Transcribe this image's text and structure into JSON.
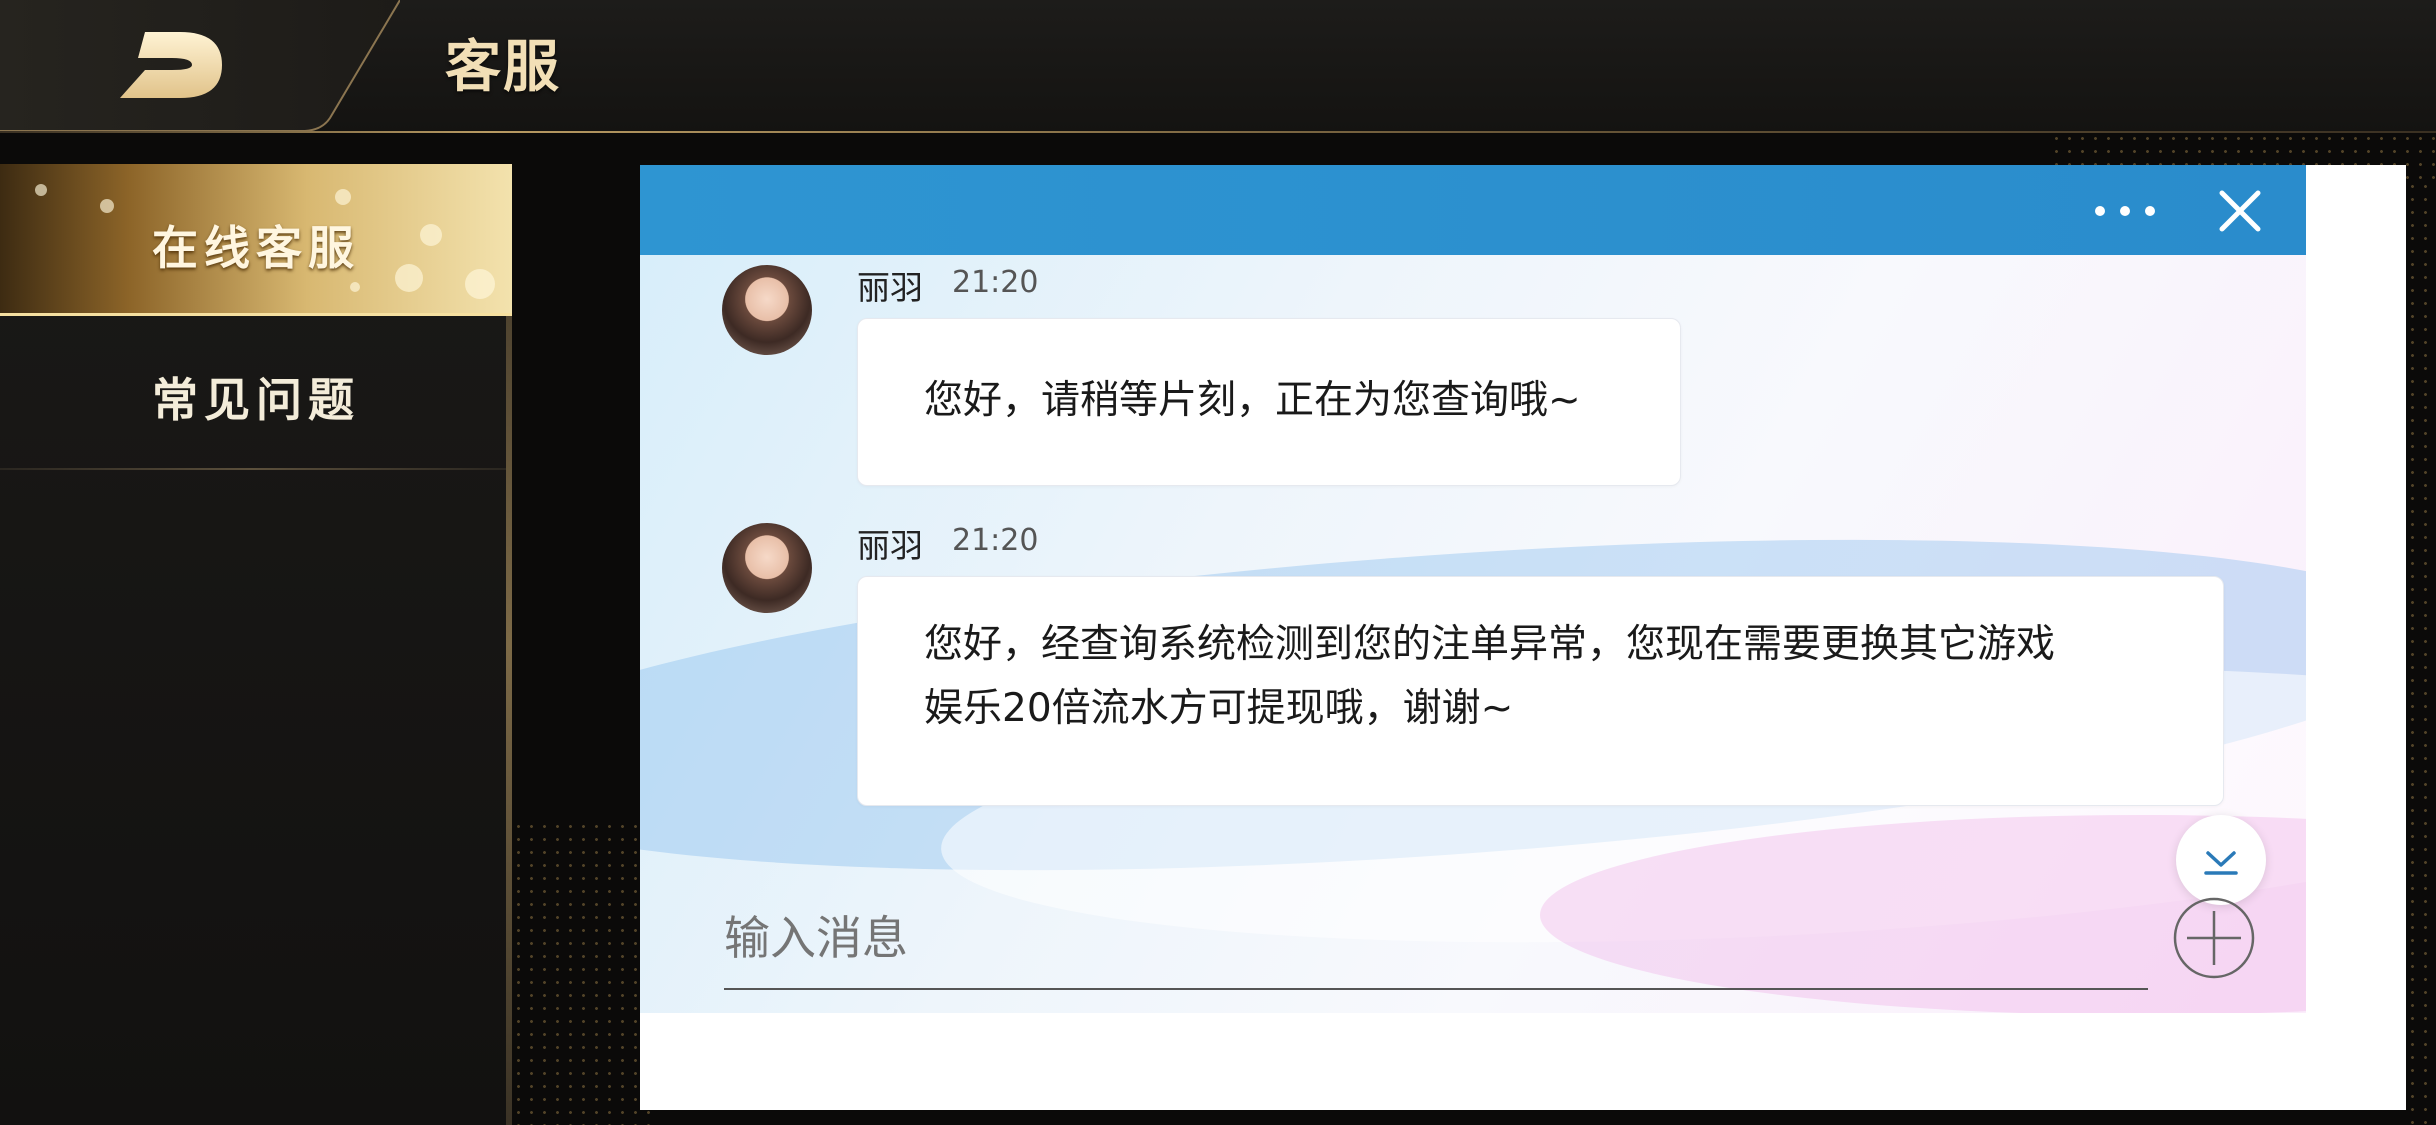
{
  "header": {
    "title": "客服"
  },
  "sidebar": {
    "items": [
      {
        "label": "在线客服",
        "active": true
      },
      {
        "label": "常见问题",
        "active": false
      }
    ]
  },
  "chat": {
    "messages": [
      {
        "sender": "丽羽",
        "time": "21:20",
        "text": "您好，请稍等片刻，正在为您查询哦~"
      },
      {
        "sender": "丽羽",
        "time": "21:20",
        "text_line1": "您好，经查询系统检测到您的注单异常，您现在需要更换其它游戏",
        "text_line2": "娱乐20倍流水方可提现哦，谢谢~"
      }
    ],
    "input": {
      "placeholder": "输入消息"
    }
  },
  "colors": {
    "header_blue": "#2e95d2",
    "gold": "#d8b871"
  }
}
